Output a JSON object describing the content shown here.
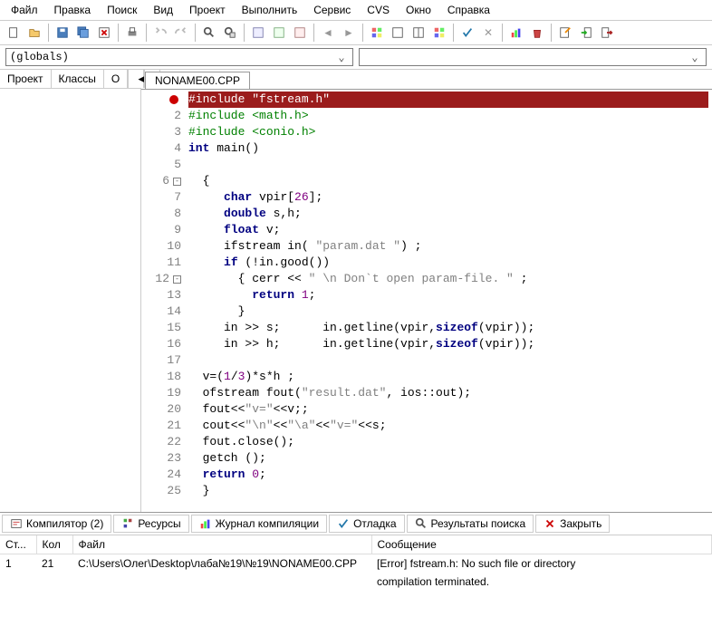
{
  "menu": [
    "Файл",
    "Правка",
    "Поиск",
    "Вид",
    "Проект",
    "Выполнить",
    "Сервис",
    "CVS",
    "Окно",
    "Справка"
  ],
  "combo1": "(globals)",
  "combo2": "",
  "leftTabs": [
    "Проект",
    "Классы",
    "О"
  ],
  "fileTab": "NONAME00.CPP",
  "code": [
    {
      "n": "",
      "gutter": "err",
      "html": "<span class='hl'>#include \"fstream.h\"</span>"
    },
    {
      "n": "2",
      "html": "<span class='pp'>#include &lt;math.h&gt;</span>"
    },
    {
      "n": "3",
      "html": "<span class='pp'>#include &lt;conio.h&gt;</span>"
    },
    {
      "n": "4",
      "html": "<span class='kw'>int</span> main()"
    },
    {
      "n": "5",
      "html": ""
    },
    {
      "n": "6",
      "fold": "-",
      "html": "  {"
    },
    {
      "n": "7",
      "html": "     <span class='kw'>char</span> vpir[<span class='num'>26</span>];"
    },
    {
      "n": "8",
      "html": "     <span class='kw'>double</span> s,h;"
    },
    {
      "n": "9",
      "html": "     <span class='kw'>float</span> v;"
    },
    {
      "n": "10",
      "html": "     ifstream in( <span class='str'>\"param.dat \"</span>) ;"
    },
    {
      "n": "11",
      "html": "     <span class='kw'>if</span> (!in.good())"
    },
    {
      "n": "12",
      "fold": "-",
      "html": "       { cerr &lt;&lt; <span class='str'>\" \\n Don`t open param-file. \"</span> ;"
    },
    {
      "n": "13",
      "html": "         <span class='kw'>return</span> <span class='num'>1</span>;"
    },
    {
      "n": "14",
      "html": "       }"
    },
    {
      "n": "15",
      "html": "     in &gt;&gt; s;      in.getline(vpir,<span class='kw'>sizeof</span>(vpir));"
    },
    {
      "n": "16",
      "html": "     in &gt;&gt; h;      in.getline(vpir,<span class='kw'>sizeof</span>(vpir));"
    },
    {
      "n": "17",
      "html": ""
    },
    {
      "n": "18",
      "html": "  v=(<span class='num'>1</span>/<span class='num'>3</span>)*s*h ;"
    },
    {
      "n": "19",
      "html": "  ofstream fout(<span class='str'>\"result.dat\"</span>, ios::out);"
    },
    {
      "n": "20",
      "html": "  fout&lt;&lt;<span class='str'>\"v=\"</span>&lt;&lt;v;;"
    },
    {
      "n": "21",
      "html": "  cout&lt;&lt;<span class='str'>\"\\n\"</span>&lt;&lt;<span class='str'>\"\\a\"</span>&lt;&lt;<span class='str'>\"v=\"</span>&lt;&lt;s;"
    },
    {
      "n": "22",
      "html": "  fout.close();"
    },
    {
      "n": "23",
      "html": "  getch ();"
    },
    {
      "n": "24",
      "html": "  <span class='kw'>return</span> <span class='num'>0</span>;"
    },
    {
      "n": "25",
      "html": "  }"
    }
  ],
  "bottomTabs": {
    "compiler": "Компилятор (2)",
    "resources": "Ресурсы",
    "log": "Журнал компиляции",
    "debug": "Отладка",
    "search": "Результаты поиска",
    "close": "Закрыть"
  },
  "tableHeaders": {
    "line": "Ст...",
    "col": "Кол",
    "file": "Файл",
    "msg": "Сообщение"
  },
  "rows": [
    {
      "line": "1",
      "col": "21",
      "file": "C:\\Users\\Олег\\Desktop\\лаба№19\\№19\\NONAME00.CPP",
      "msg": "[Error] fstream.h: No such file or directory"
    },
    {
      "line": "",
      "col": "",
      "file": "",
      "msg": "compilation terminated."
    }
  ]
}
